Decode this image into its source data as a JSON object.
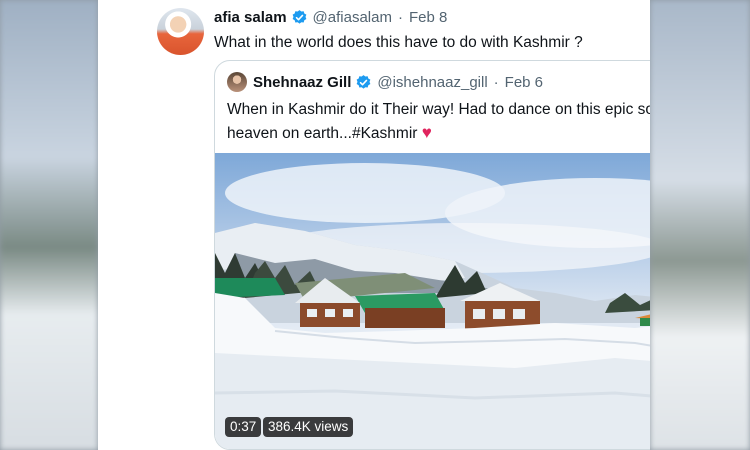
{
  "tweet": {
    "author_name": "afia salam",
    "handle": "@afiasalam",
    "separator": "·",
    "date": "Feb 8",
    "text": "What in the world does this have to do with Kashmir ?",
    "more_icon": "more-horizontal-icon"
  },
  "quoted_tweet": {
    "author_name": "Shehnaaz Gill",
    "handle": "@ishehnaaz_gill",
    "separator": "·",
    "date": "Feb 6",
    "text": "When in Kashmir do it Their way! Had to dance on this epic song at the heaven on earth...#Kashmir",
    "emoji": "♥",
    "video": {
      "duration": "0:37",
      "views": "386.4K views"
    }
  },
  "colors": {
    "verified": "#1d9bf0",
    "text_primary": "#0f1419",
    "text_secondary": "#536471",
    "border": "#cfd9de",
    "heart": "#e0245e"
  }
}
